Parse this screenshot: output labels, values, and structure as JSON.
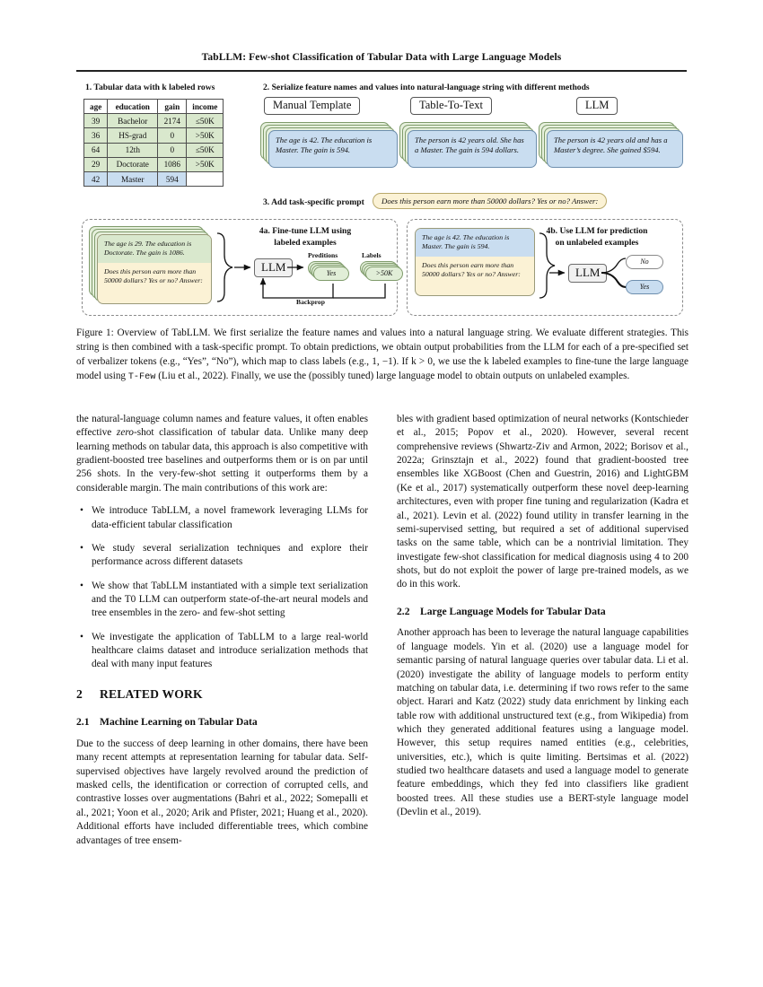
{
  "running_head": "TabLLM: Few-shot Classification of Tabular Data with Large Language Models",
  "figure": {
    "step1_label": "1. Tabular data with k labeled rows",
    "step2_label": "2. Serialize feature names and values into natural-language string with different methods",
    "step3_label": "3. Add task-specific prompt",
    "table": {
      "headers": [
        "age",
        "education",
        "gain",
        "income"
      ],
      "rows": [
        {
          "age": "39",
          "education": "Bachelor",
          "gain": "2174",
          "income": "≤50K",
          "style": "green"
        },
        {
          "age": "36",
          "education": "HS-grad",
          "gain": "0",
          "income": ">50K",
          "style": "green"
        },
        {
          "age": "64",
          "education": "12th",
          "gain": "0",
          "income": "≤50K",
          "style": "green"
        },
        {
          "age": "29",
          "education": "Doctorate",
          "gain": "1086",
          "income": ">50K",
          "style": "green"
        },
        {
          "age": "42",
          "education": "Master",
          "gain": "594",
          "income": "",
          "style": "blue"
        }
      ]
    },
    "methods": [
      {
        "title": "Manual Template",
        "text": "The age is 42. The education is Master. The gain is 594."
      },
      {
        "title": "Table-To-Text",
        "text": "The person is 42 years old. She has a Master. The gain is 594 dollars."
      },
      {
        "title": "LLM",
        "text": "The person is 42 years old and has a Master’s degree. She gained $594."
      }
    ],
    "prompt": "Does this person earn more than 50000 dollars? Yes or no? Answer:",
    "panel_a": {
      "title_line1": "4a. Fine-tune LLM using",
      "title_line2": "labeled examples",
      "card_serialized": "The age is 29. The education is Doctorate. The gain is 1086.",
      "card_prompt": "Does this person earn more than 50000 dollars? Yes or no? Answer:",
      "llm_label": "LLM",
      "predictions_label": "Preditions",
      "labels_label": "Labels",
      "prediction_value": "Yes",
      "label_value": ">50K",
      "backprop_label": "Backprop"
    },
    "panel_b": {
      "title_line1": "4b. Use LLM for prediction",
      "title_line2": "on unlabeled examples",
      "card_serialized": "The age is 42. The education is Master. The gain is 594.",
      "card_prompt": "Does this person earn more than 50000 dollars? Yes or no? Answer:",
      "llm_label": "LLM",
      "option_no": "No",
      "option_yes": "Yes"
    }
  },
  "caption": {
    "p1": "Figure 1: Overview of TabLLM. We first serialize the feature names and values into a natural language string. We evaluate different strategies. This string is then combined with a task-specific prompt. To obtain predictions, we obtain output probabilities from the LLM for each of a pre-specified set of verbalizer tokens (e.g., “Yes”, “No”), which map to class labels (e.g., 1, −1). If k > 0, we use the k labeled examples to fine-tune the large language model using ",
    "mono": "T-Few",
    "p2": " (Liu et al., 2022). Finally, we use the (possibly tuned) large language model to obtain outputs on unlabeled examples."
  },
  "left_column": {
    "intro_a": "the natural-language column names and feature values, it often enables effective ",
    "intro_italic": "zero",
    "intro_b": "-shot classification of tabular data. Unlike many deep learning methods on tabular data, this approach is also competitive with gradient-boosted tree baselines and outperforms them or is on par until 256 shots. In the very-few-shot setting it outperforms them by a considerable margin. The main contributions of this work are:",
    "bullets": [
      "We introduce TabLLM, a novel framework leveraging LLMs for data-efficient tabular classification",
      "We study several serialization techniques and explore their performance across different datasets",
      "We show that TabLLM instantiated with a simple text serialization and the T0 LLM can outperform state-of-the-art neural models and tree ensembles in the zero- and few-shot setting",
      "We investigate the application of TabLLM to a large real-world healthcare claims dataset and introduce serialization methods that deal with many input features"
    ],
    "section_num": "2",
    "section_title": "RELATED WORK",
    "subsection_num": "2.1",
    "subsection_title": "Machine Learning on Tabular Data",
    "para": "Due to the success of deep learning in other domains, there have been many recent attempts at representation learning for tabular data. Self-supervised objectives have largely revolved around the prediction of masked cells, the identification or correction of corrupted cells, and contrastive losses over augmentations (Bahri et al., 2022; Somepalli et al., 2021; Yoon et al., 2020; Arik and Pfister, 2021; Huang et al., 2020). Additional efforts have included differentiable trees, which combine advantages of tree ensem-"
  },
  "right_column": {
    "para1": "bles with gradient based optimization of neural networks (Kontschieder et al., 2015; Popov et al., 2020). However, several recent comprehensive reviews (Shwartz-Ziv and Armon, 2022; Borisov et al., 2022a; Grinsztajn et al., 2022) found that gradient-boosted tree ensembles like XGBoost (Chen and Guestrin, 2016) and LightGBM (Ke et al., 2017) systematically outperform these novel deep-learning architectures, even with proper fine tuning and regularization (Kadra et al., 2021). Levin et al. (2022) found utility in transfer learning in the semi-supervised setting, but required a set of additional supervised tasks on the same table, which can be a nontrivial limitation. They investigate few-shot classification for medical diagnosis using 4 to 200 shots, but do not exploit the power of large pre-trained models, as we do in this work.",
    "subsection_num": "2.2",
    "subsection_title": "Large Language Models for Tabular Data",
    "para2": "Another approach has been to leverage the natural language capabilities of language models. Yin et al. (2020) use a language model for semantic parsing of natural language queries over tabular data. Li et al. (2020) investigate the ability of language models to perform entity matching on tabular data, i.e. determining if two rows refer to the same object. Harari and Katz (2022) study data enrichment by linking each table row with additional unstructured text (e.g., from Wikipedia) from which they generated additional features using a language model. However, this setup requires named entities (e.g., celebrities, universities, etc.), which is quite limiting. Bertsimas et al. (2022) studied two healthcare datasets and used a language model to generate feature embeddings, which they fed into classifiers like gradient boosted trees. All these studies use a BERT-style language model (Devlin et al., 2019)."
  },
  "colors": {
    "green_row": "#d9e8cd",
    "blue_row": "#c9ddf0",
    "cream": "#fbf2d5",
    "green_card": "#e6f0dc",
    "rule": "#222222"
  }
}
